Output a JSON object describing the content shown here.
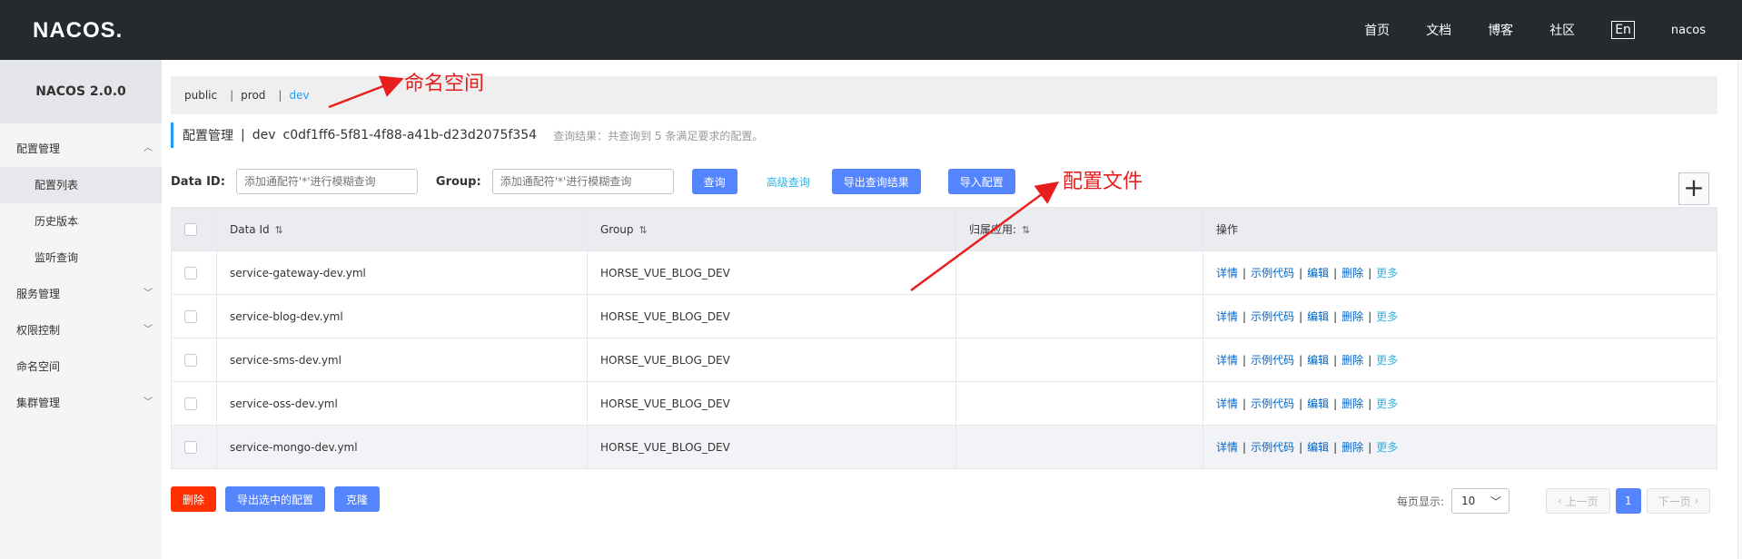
{
  "header": {
    "logo": "NACOS.",
    "nav": [
      "首页",
      "文档",
      "博客",
      "社区"
    ],
    "lang": "En",
    "user": "nacos"
  },
  "sidebar": {
    "title": "NACOS 2.0.0",
    "items": [
      {
        "label": "配置管理",
        "type": "group",
        "expanded": true
      },
      {
        "label": "配置列表",
        "type": "sub",
        "active": true
      },
      {
        "label": "历史版本",
        "type": "sub"
      },
      {
        "label": "监听查询",
        "type": "sub"
      },
      {
        "label": "服务管理",
        "type": "group"
      },
      {
        "label": "权限控制",
        "type": "group"
      },
      {
        "label": "命名空间",
        "type": "item"
      },
      {
        "label": "集群管理",
        "type": "group"
      }
    ]
  },
  "namespaces": {
    "items": [
      "public",
      "prod",
      "dev"
    ],
    "active": "dev"
  },
  "breadcrumb": {
    "title": "配置管理",
    "sep": "|",
    "namespace": "dev",
    "namespace_id": "c0df1ff6-5f81-4f88-a41b-d23d2075f354",
    "result": "查询结果：共查询到 5 条满足要求的配置。"
  },
  "filter": {
    "dataid_label": "Data ID:",
    "dataid_placeholder": "添加通配符'*'进行模糊查询",
    "group_label": "Group:",
    "group_placeholder": "添加通配符'*'进行模糊查询",
    "query_btn": "查询",
    "advanced": "高级查询",
    "export_btn": "导出查询结果",
    "import_btn": "导入配置",
    "plus": "+"
  },
  "table": {
    "headers": [
      "Data Id",
      "Group",
      "归属应用:",
      "操作"
    ],
    "rows": [
      {
        "dataid": "service-gateway-dev.yml",
        "group": "HORSE_VUE_BLOG_DEV",
        "app": ""
      },
      {
        "dataid": "service-blog-dev.yml",
        "group": "HORSE_VUE_BLOG_DEV",
        "app": ""
      },
      {
        "dataid": "service-sms-dev.yml",
        "group": "HORSE_VUE_BLOG_DEV",
        "app": ""
      },
      {
        "dataid": "service-oss-dev.yml",
        "group": "HORSE_VUE_BLOG_DEV",
        "app": ""
      },
      {
        "dataid": "service-mongo-dev.yml",
        "group": "HORSE_VUE_BLOG_DEV",
        "app": ""
      }
    ],
    "ops": [
      "详情",
      "示例代码",
      "编辑",
      "删除",
      "更多"
    ]
  },
  "bottom": {
    "delete_btn": "删除",
    "export_selected_btn": "导出选中的配置",
    "clone_btn": "克隆"
  },
  "pagination": {
    "per_page_label": "每页显示:",
    "per_page": "10",
    "prev": "上一页",
    "page": "1",
    "next": "下一页"
  },
  "annotations": {
    "namespace_note": "命名空间",
    "config_note": "配置文件",
    "color": "#e81e1e"
  }
}
